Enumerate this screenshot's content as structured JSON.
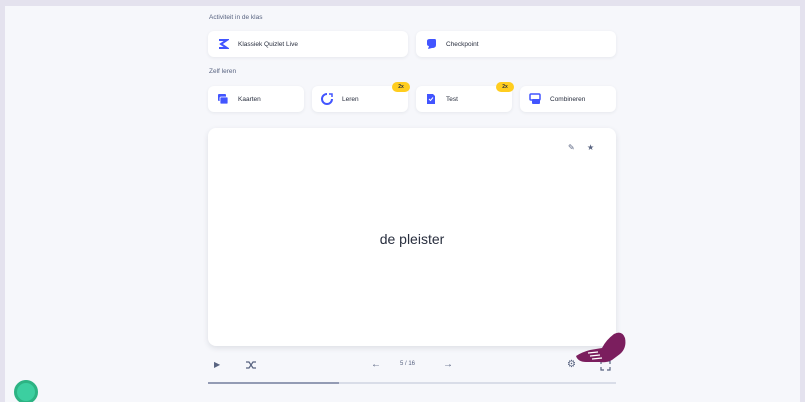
{
  "sections": {
    "class_activities_label": "Activiteit in de klas",
    "self_study_label": "Zelf leren"
  },
  "class_activities": [
    {
      "label": "Klassiek Quizlet Live",
      "icon": "quizlet-live-icon"
    },
    {
      "label": "Checkpoint",
      "icon": "checkpoint-icon"
    }
  ],
  "study_modes": [
    {
      "label": "Kaarten",
      "icon": "flashcards-icon",
      "badge": ""
    },
    {
      "label": "Leren",
      "icon": "learn-icon",
      "badge": "2x"
    },
    {
      "label": "Test",
      "icon": "test-icon",
      "badge": "2x"
    },
    {
      "label": "Combineren",
      "icon": "match-icon",
      "badge": ""
    }
  ],
  "flashcard": {
    "term": "de pleister"
  },
  "controls": {
    "counter": "5 / 16",
    "progress_fraction": 0.32
  },
  "colors": {
    "accent": "#4255ff",
    "badge": "#ffcd1f",
    "hand": "#7b1e5e",
    "help": "#3ccfa0"
  }
}
